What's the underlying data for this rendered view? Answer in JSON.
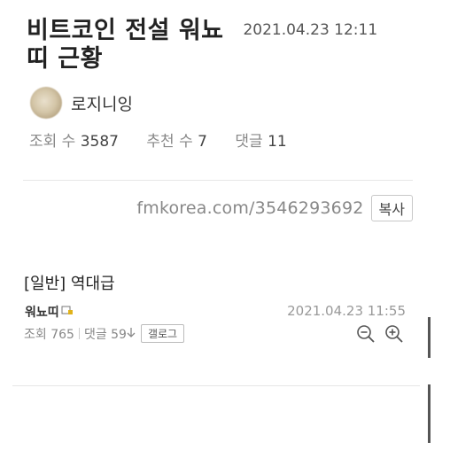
{
  "post": {
    "title_line1": "비트코인 전설 워뇨",
    "title_line2": "띠 근황",
    "date": "2021.04.23 12:11",
    "author": "로지니잉",
    "views_label": "조회 수",
    "views": "3587",
    "recommend_label": "추천 수",
    "recommend": "7",
    "comments_label": "댓글",
    "comments": "11",
    "url": "fmkorea.com/3546293692",
    "copy_label": "복사"
  },
  "embedded_post": {
    "title": "[일반] 역대급",
    "author": "워뇨띠",
    "date": "2021.04.23 11:55",
    "views": "조회 765",
    "comments": "댓글 59",
    "gallery_label": "갤로그"
  },
  "icons": {
    "avatar": "avatar-image",
    "level_badge": "level-badge-icon",
    "zoom_out": "zoom-out-icon",
    "zoom_in": "zoom-in-icon",
    "comment_arrow": "arrow-down-icon"
  }
}
